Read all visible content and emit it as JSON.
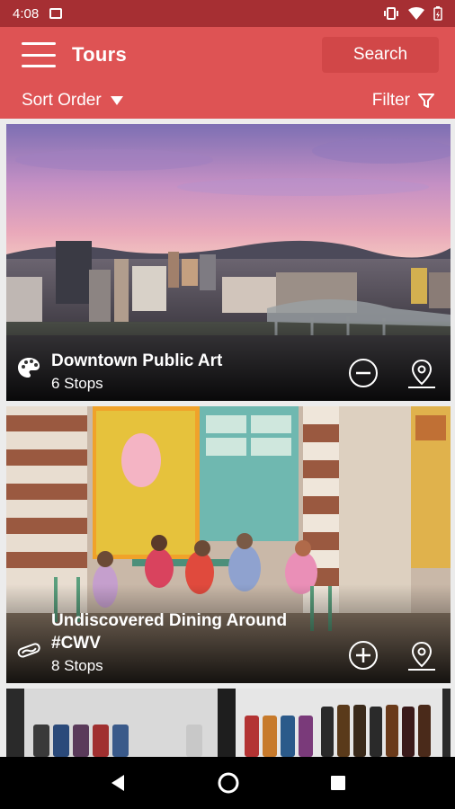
{
  "status_bar": {
    "time": "4:08"
  },
  "app_bar": {
    "title": "Tours",
    "search_label": "Search"
  },
  "sub_bar": {
    "sort_label": "Sort Order",
    "filter_label": "Filter"
  },
  "tours": [
    {
      "title": "Downtown Public Art",
      "stops": "6 Stops",
      "category_icon": "palette-icon",
      "action": "remove"
    },
    {
      "title_line1": "Undiscovered Dining Around",
      "title_line2": "#CWV",
      "stops": "8 Stops",
      "category_icon": "hot-dog-icon",
      "action": "add"
    },
    {
      "title": "",
      "stops": ""
    }
  ],
  "colors": {
    "status_bar": "#a62f33",
    "app_bar": "#de5354",
    "search_button": "#d14748"
  }
}
